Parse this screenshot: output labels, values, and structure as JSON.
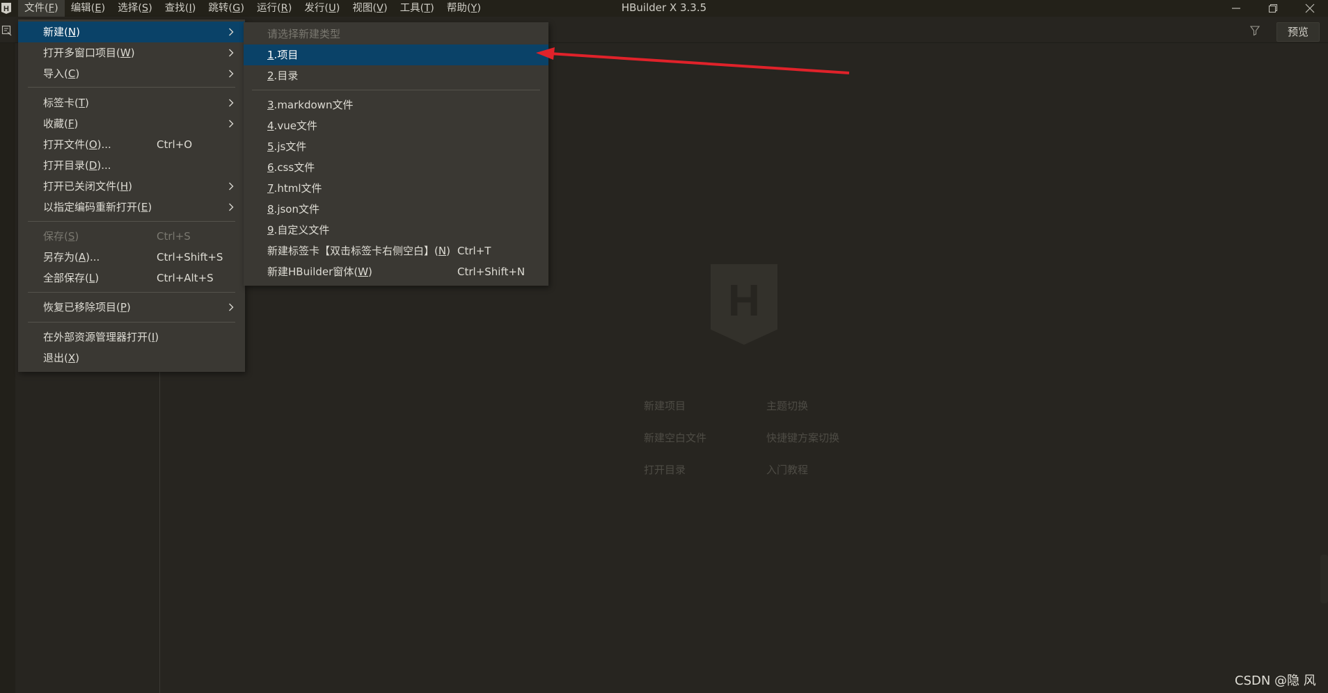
{
  "window": {
    "title": "HBuilder X 3.3.5"
  },
  "menubar": {
    "items": [
      {
        "label": "文件(",
        "key": "F",
        "end": ")"
      },
      {
        "label": "编辑(",
        "key": "E",
        "end": ")"
      },
      {
        "label": "选择(",
        "key": "S",
        "end": ")"
      },
      {
        "label": "查找(",
        "key": "I",
        "end": ")"
      },
      {
        "label": "跳转(",
        "key": "G",
        "end": ")"
      },
      {
        "label": "运行(",
        "key": "R",
        "end": ")"
      },
      {
        "label": "发行(",
        "key": "U",
        "end": ")"
      },
      {
        "label": "视图(",
        "key": "V",
        "end": ")"
      },
      {
        "label": "工具(",
        "key": "T",
        "end": ")"
      },
      {
        "label": "帮助(",
        "key": "Y",
        "end": ")"
      }
    ]
  },
  "toolbar": {
    "preview_label": "预览"
  },
  "file_menu": {
    "items": [
      {
        "pre": "新建(",
        "key": "N",
        "post": ")",
        "shortcut": ""
      },
      {
        "pre": "打开多窗口项目(",
        "key": "W",
        "post": ")",
        "shortcut": ""
      },
      {
        "pre": "导入(",
        "key": "C",
        "post": ")",
        "shortcut": ""
      },
      {
        "pre": "标签卡(",
        "key": "T",
        "post": ")",
        "shortcut": ""
      },
      {
        "pre": "收藏(",
        "key": "F",
        "post": ")",
        "shortcut": ""
      },
      {
        "pre": "打开文件(",
        "key": "O",
        "post": ")...",
        "shortcut": "Ctrl+O"
      },
      {
        "pre": "打开目录(",
        "key": "D",
        "post": ")...",
        "shortcut": ""
      },
      {
        "pre": "打开已关闭文件(",
        "key": "H",
        "post": ")",
        "shortcut": ""
      },
      {
        "pre": "以指定编码重新打开(",
        "key": "E",
        "post": ")",
        "shortcut": ""
      },
      {
        "pre": "保存(",
        "key": "S",
        "post": ")",
        "shortcut": "Ctrl+S"
      },
      {
        "pre": "另存为(",
        "key": "A",
        "post": ")...",
        "shortcut": "Ctrl+Shift+S"
      },
      {
        "pre": "全部保存(",
        "key": "L",
        "post": ")",
        "shortcut": "Ctrl+Alt+S"
      },
      {
        "pre": "恢复已移除项目(",
        "key": "P",
        "post": ")",
        "shortcut": ""
      },
      {
        "pre": "在外部资源管理器打开(",
        "key": "I",
        "post": ")",
        "shortcut": ""
      },
      {
        "pre": "退出(",
        "key": "X",
        "post": ")",
        "shortcut": ""
      }
    ]
  },
  "new_submenu": {
    "header": "请选择新建类型",
    "items": [
      {
        "key": "1",
        "text": ".项目",
        "shortcut": ""
      },
      {
        "key": "2",
        "text": ".目录",
        "shortcut": ""
      },
      {
        "key": "3",
        "text": ".markdown文件",
        "shortcut": ""
      },
      {
        "key": "4",
        "text": ".vue文件",
        "shortcut": ""
      },
      {
        "key": "5",
        "text": ".js文件",
        "shortcut": ""
      },
      {
        "key": "6",
        "text": ".css文件",
        "shortcut": ""
      },
      {
        "key": "7",
        "text": ".html文件",
        "shortcut": ""
      },
      {
        "key": "8",
        "text": ".json文件",
        "shortcut": ""
      },
      {
        "key": "9",
        "text": ".自定义文件",
        "shortcut": ""
      }
    ],
    "new_tab": {
      "pre": "新建标签卡【双击标签卡右侧空白】(",
      "key": "N",
      "post": ")",
      "shortcut": "Ctrl+T"
    },
    "new_window": {
      "pre": "新建HBuilder窗体(",
      "key": "W",
      "post": ")",
      "shortcut": "Ctrl+Shift+N"
    }
  },
  "welcome": {
    "logo_letter": "H",
    "links": [
      "新建项目",
      "主题切换",
      "新建空白文件",
      "快捷键方案切换",
      "打开目录",
      "入门教程"
    ]
  },
  "watermark": "CSDN @隐 风",
  "colors": {
    "highlight": "#0a4268",
    "annotation_arrow": "#e0222a"
  }
}
